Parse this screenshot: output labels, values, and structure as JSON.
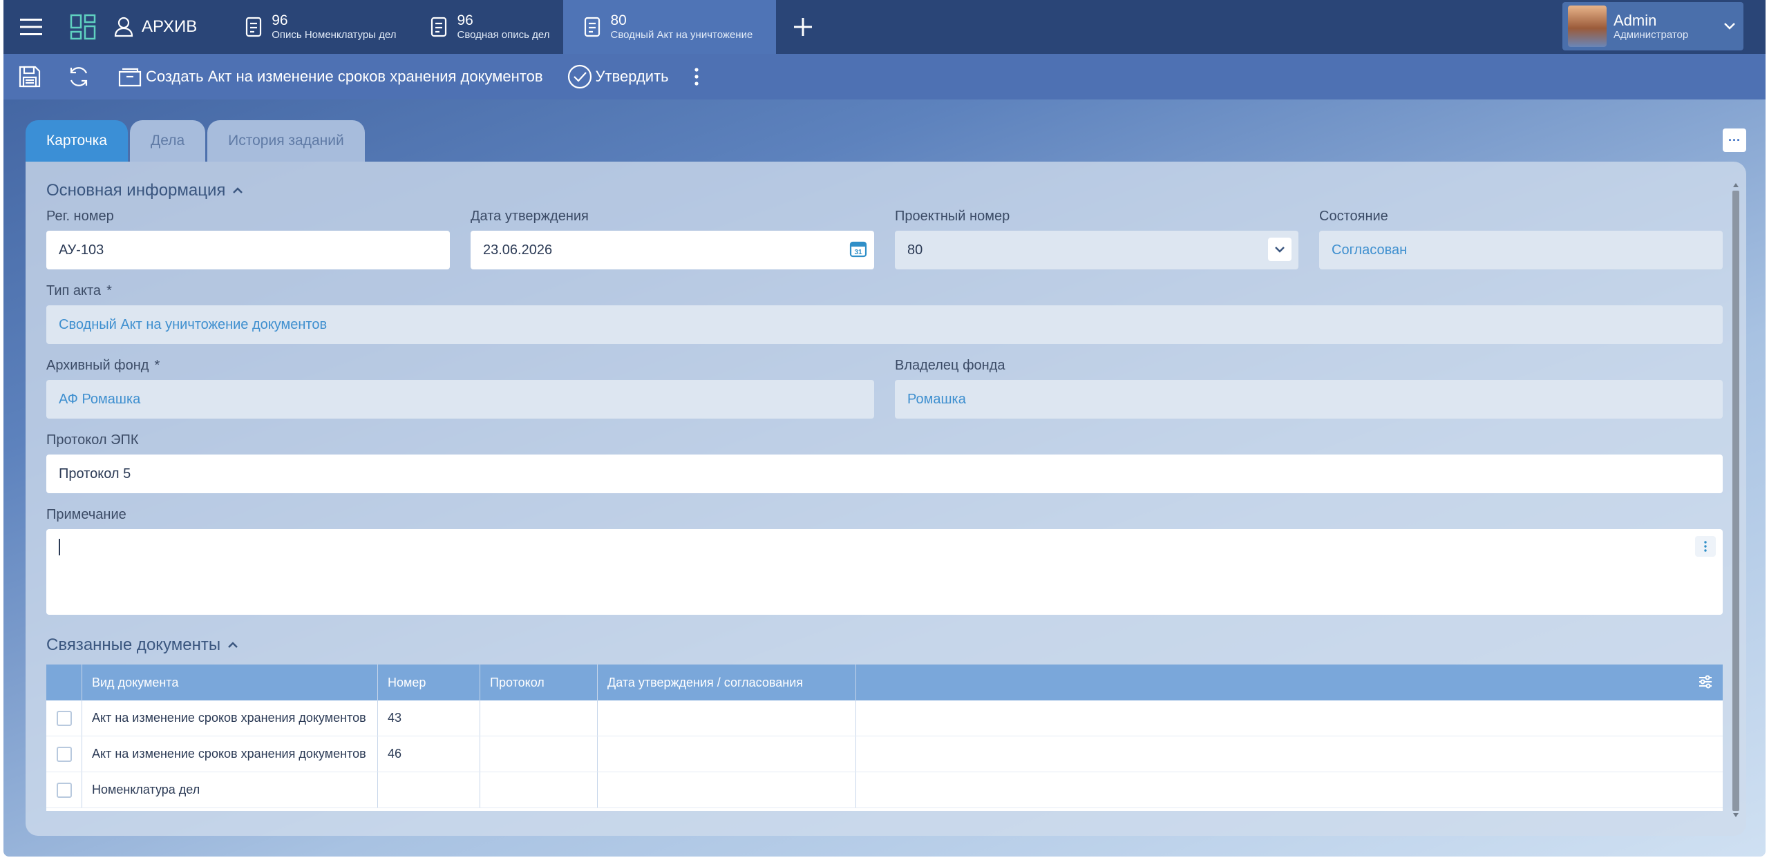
{
  "topbar": {
    "archive_label": "АРХИВ",
    "tabs": [
      {
        "number": "96",
        "subtitle": "Опись Номенклатуры дел"
      },
      {
        "number": "96",
        "subtitle": "Сводная опись дел"
      },
      {
        "number": "80",
        "subtitle": "Сводный Акт на уничтожение"
      }
    ],
    "user": {
      "name": "Admin",
      "role": "Администратор"
    }
  },
  "toolbar": {
    "create_label": "Создать Акт на изменение сроков хранения документов",
    "approve_label": "Утвердить"
  },
  "tabs": [
    "Карточка",
    "Дела",
    "История заданий"
  ],
  "more_label": "···",
  "main_info": {
    "title": "Основная информация",
    "reg_number": {
      "label": "Рег. номер",
      "value": "АУ-103"
    },
    "approval_date": {
      "label": "Дата утверждения",
      "value": "23.06.2026"
    },
    "project_number": {
      "label": "Проектный номер",
      "value": "80"
    },
    "state": {
      "label": "Состояние",
      "value": "Согласован"
    },
    "act_type": {
      "label": "Тип акта",
      "required": "*",
      "value": "Сводный Акт на уничтожение документов"
    },
    "archive_fund": {
      "label": "Архивный фонд",
      "required": "*",
      "value": "АФ Ромашка"
    },
    "fund_owner": {
      "label": "Владелец фонда",
      "value": "Ромашка"
    },
    "epk_protocol": {
      "label": "Протокол ЭПК",
      "value": "Протокол 5"
    },
    "note": {
      "label": "Примечание",
      "value": ""
    }
  },
  "related": {
    "title": "Связанные документы",
    "columns": [
      "Вид документа",
      "Номер",
      "Протокол",
      "Дата утверждения / согласования"
    ],
    "rows": [
      {
        "type": "Акт на изменение сроков хранения документов",
        "number": "43",
        "protocol": "",
        "date": ""
      },
      {
        "type": "Акт на изменение сроков хранения документов",
        "number": "46",
        "protocol": "",
        "date": ""
      },
      {
        "type": "Номенклатура дел",
        "number": "",
        "protocol": "",
        "date": ""
      }
    ]
  },
  "colors": {
    "topbar": "#2a4577",
    "toolbar": "#4e71b3",
    "active_tab": "#3b8fd6",
    "table_header": "#7aa7da",
    "link_text": "#3e8fcf"
  }
}
